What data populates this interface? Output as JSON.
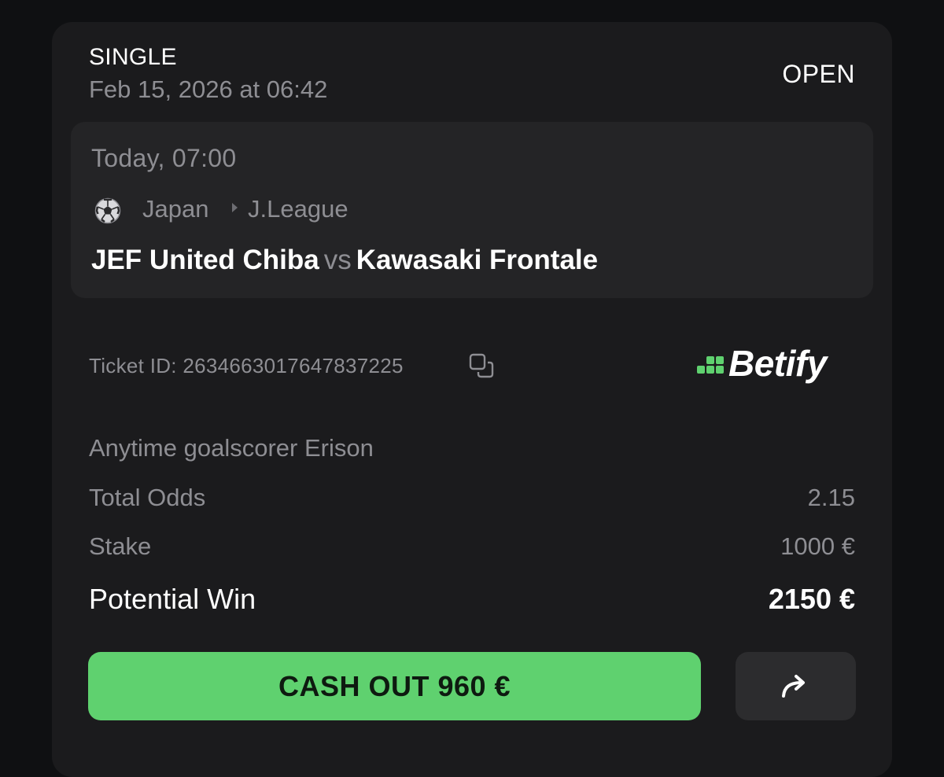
{
  "bet": {
    "type": "SINGLE",
    "placed_at": "Feb 15, 2026 at 06:42",
    "status": "OPEN"
  },
  "event": {
    "kickoff": "Today, 07:00",
    "sport_icon": "soccer-ball-icon",
    "country": "Japan",
    "league": "J.League",
    "home_team": "JEF United Chiba",
    "vs": "vs",
    "away_team": "Kawasaki Frontale"
  },
  "ticket": {
    "label": "Ticket ID: 2634663017647837225",
    "copy_icon": "copy-icon"
  },
  "brand": {
    "name": "Betify",
    "mark_color": "#5fd16f"
  },
  "selection": {
    "market": "Anytime goalscorer Erison"
  },
  "summary": {
    "total_odds_label": "Total Odds",
    "total_odds_value": "2.15",
    "stake_label": "Stake",
    "stake_value": "1000 €",
    "potential_win_label": "Potential Win",
    "potential_win_value": "2150 €"
  },
  "actions": {
    "cashout_label": "CASH OUT 960 €",
    "share_icon": "share-arrow-icon"
  },
  "colors": {
    "accent": "#5fd16f",
    "card_bg": "#1b1b1d",
    "event_bg": "#242426",
    "muted_text": "#8e8e93"
  }
}
